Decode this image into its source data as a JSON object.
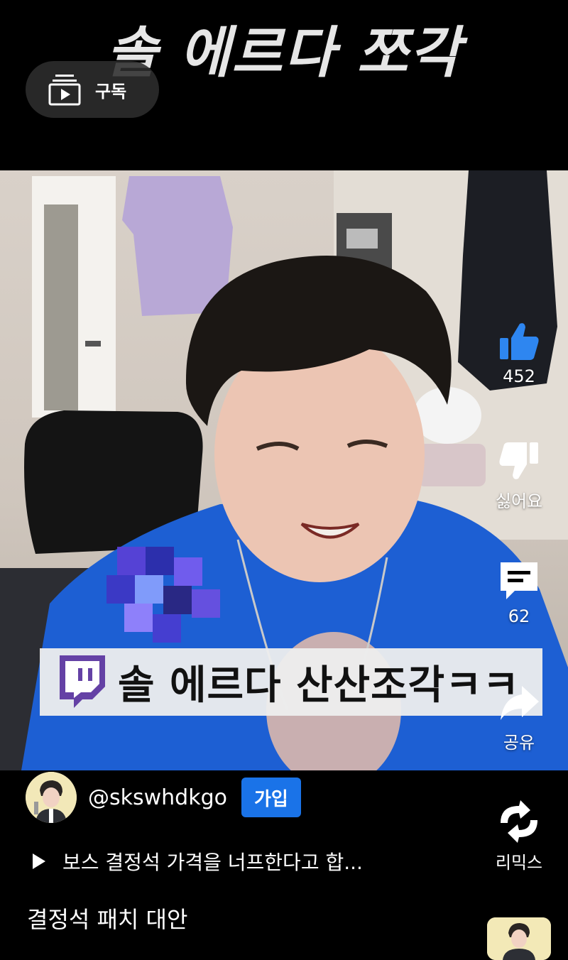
{
  "header": {
    "video_title": "솔 에르다 쪼각",
    "subscribe_label": "구독"
  },
  "overlay": {
    "caption": "솔 에르다 산산조각ㅋㅋ"
  },
  "actions": {
    "like_count": "452",
    "dislike_label": "싫어요",
    "comment_count": "62",
    "share_label": "공유",
    "remix_label": "리믹스"
  },
  "channel": {
    "handle": "@skswhdkgo",
    "join_label": "가입"
  },
  "description": {
    "text": "보스 결정석 가격을 너프한다고 합..."
  },
  "caption_line": "결정석 패치 대안",
  "colors": {
    "join_button": "#1a73e8",
    "like_icon": "#2e86f0",
    "background": "#000000"
  },
  "icons": {
    "subscribe": "subscriptions-icon",
    "like": "thumbs-up-icon",
    "dislike": "thumbs-down-icon",
    "comment": "comment-icon",
    "share": "share-icon",
    "remix": "remix-icon",
    "twitch": "twitch-logo"
  }
}
